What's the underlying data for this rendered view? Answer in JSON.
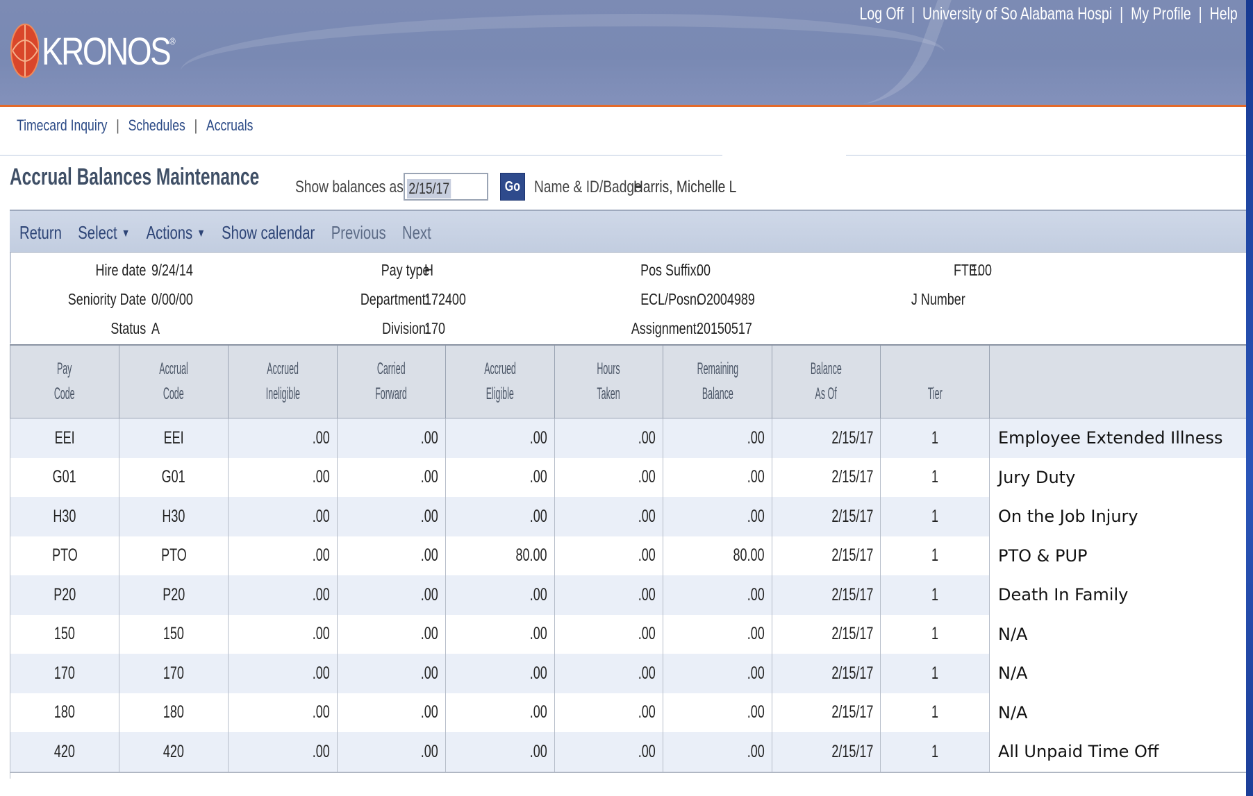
{
  "header": {
    "logo_text": "KRONOS",
    "logo_reg": "®",
    "links": [
      "Log Off",
      "University of So Alabama Hospi",
      "My Profile",
      "Help"
    ]
  },
  "nav": [
    "Timecard Inquiry",
    "Schedules",
    "Accruals"
  ],
  "page": {
    "title": "Accrual Balances Maintenance",
    "show_label": "Show balances as of",
    "date_value": "2/15/17",
    "go_label": "Go",
    "name_label": "Name & ID/Badge",
    "name_value": "Harris, Michelle L"
  },
  "toolbar": {
    "return": "Return",
    "select": "Select",
    "actions": "Actions",
    "show_calendar": "Show calendar",
    "previous": "Previous",
    "next": "Next"
  },
  "info": {
    "hire_date_label": "Hire date",
    "hire_date": "9/24/14",
    "seniority_label": "Seniority Date",
    "seniority": "0/00/00",
    "status_label": "Status",
    "status": "A",
    "pay_type_label": "Pay type",
    "pay_type": "H",
    "department_label": "Department:",
    "department": "172400",
    "division_label": "Division:",
    "division": "170",
    "pos_suffix_label": "Pos Suffix:",
    "pos_suffix": "00",
    "ecl_label": "ECL/Posn:",
    "ecl": "O2004989",
    "assignment_label": "Assignment:",
    "assignment": "20150517",
    "fte_label": "FTE:",
    "fte": "100",
    "jnumber_label": "J Number"
  },
  "table": {
    "headers": [
      [
        "Pay",
        "Code"
      ],
      [
        "Accrual",
        "Code"
      ],
      [
        "Accrued",
        "Ineligible"
      ],
      [
        "Carried",
        "Forward"
      ],
      [
        "Accrued",
        "Eligible"
      ],
      [
        "Hours",
        "Taken"
      ],
      [
        "Remaining",
        "Balance"
      ],
      [
        "Balance",
        "As Of"
      ],
      [
        "",
        "Tier"
      ],
      [
        "",
        ""
      ]
    ],
    "rows": [
      {
        "pay": "EEI",
        "accrual": "EEI",
        "ineligible": ".00",
        "carried": ".00",
        "eligible": ".00",
        "taken": ".00",
        "remaining": ".00",
        "asof": "2/15/17",
        "tier": "1",
        "desc": "Employee Extended Illness"
      },
      {
        "pay": "G01",
        "accrual": "G01",
        "ineligible": ".00",
        "carried": ".00",
        "eligible": ".00",
        "taken": ".00",
        "remaining": ".00",
        "asof": "2/15/17",
        "tier": "1",
        "desc": "Jury Duty"
      },
      {
        "pay": "H30",
        "accrual": "H30",
        "ineligible": ".00",
        "carried": ".00",
        "eligible": ".00",
        "taken": ".00",
        "remaining": ".00",
        "asof": "2/15/17",
        "tier": "1",
        "desc": "On the Job Injury"
      },
      {
        "pay": "PTO",
        "accrual": "PTO",
        "ineligible": ".00",
        "carried": ".00",
        "eligible": "80.00",
        "taken": ".00",
        "remaining": "80.00",
        "asof": "2/15/17",
        "tier": "1",
        "desc": "PTO & PUP"
      },
      {
        "pay": "P20",
        "accrual": "P20",
        "ineligible": ".00",
        "carried": ".00",
        "eligible": ".00",
        "taken": ".00",
        "remaining": ".00",
        "asof": "2/15/17",
        "tier": "1",
        "desc": "Death In Family"
      },
      {
        "pay": "150",
        "accrual": "150",
        "ineligible": ".00",
        "carried": ".00",
        "eligible": ".00",
        "taken": ".00",
        "remaining": ".00",
        "asof": "2/15/17",
        "tier": "1",
        "desc": "N/A"
      },
      {
        "pay": "170",
        "accrual": "170",
        "ineligible": ".00",
        "carried": ".00",
        "eligible": ".00",
        "taken": ".00",
        "remaining": ".00",
        "asof": "2/15/17",
        "tier": "1",
        "desc": "N/A"
      },
      {
        "pay": "180",
        "accrual": "180",
        "ineligible": ".00",
        "carried": ".00",
        "eligible": ".00",
        "taken": ".00",
        "remaining": ".00",
        "asof": "2/15/17",
        "tier": "1",
        "desc": "N/A"
      },
      {
        "pay": "420",
        "accrual": "420",
        "ineligible": ".00",
        "carried": ".00",
        "eligible": ".00",
        "taken": ".00",
        "remaining": ".00",
        "asof": "2/15/17",
        "tier": "1",
        "desc": "All Unpaid Time Off"
      }
    ]
  },
  "colors": {
    "header_bg": "#7c8bb4",
    "accent_orange": "#e46a2a",
    "link_blue": "#2b4a86",
    "go_button": "#2e4a8c"
  }
}
